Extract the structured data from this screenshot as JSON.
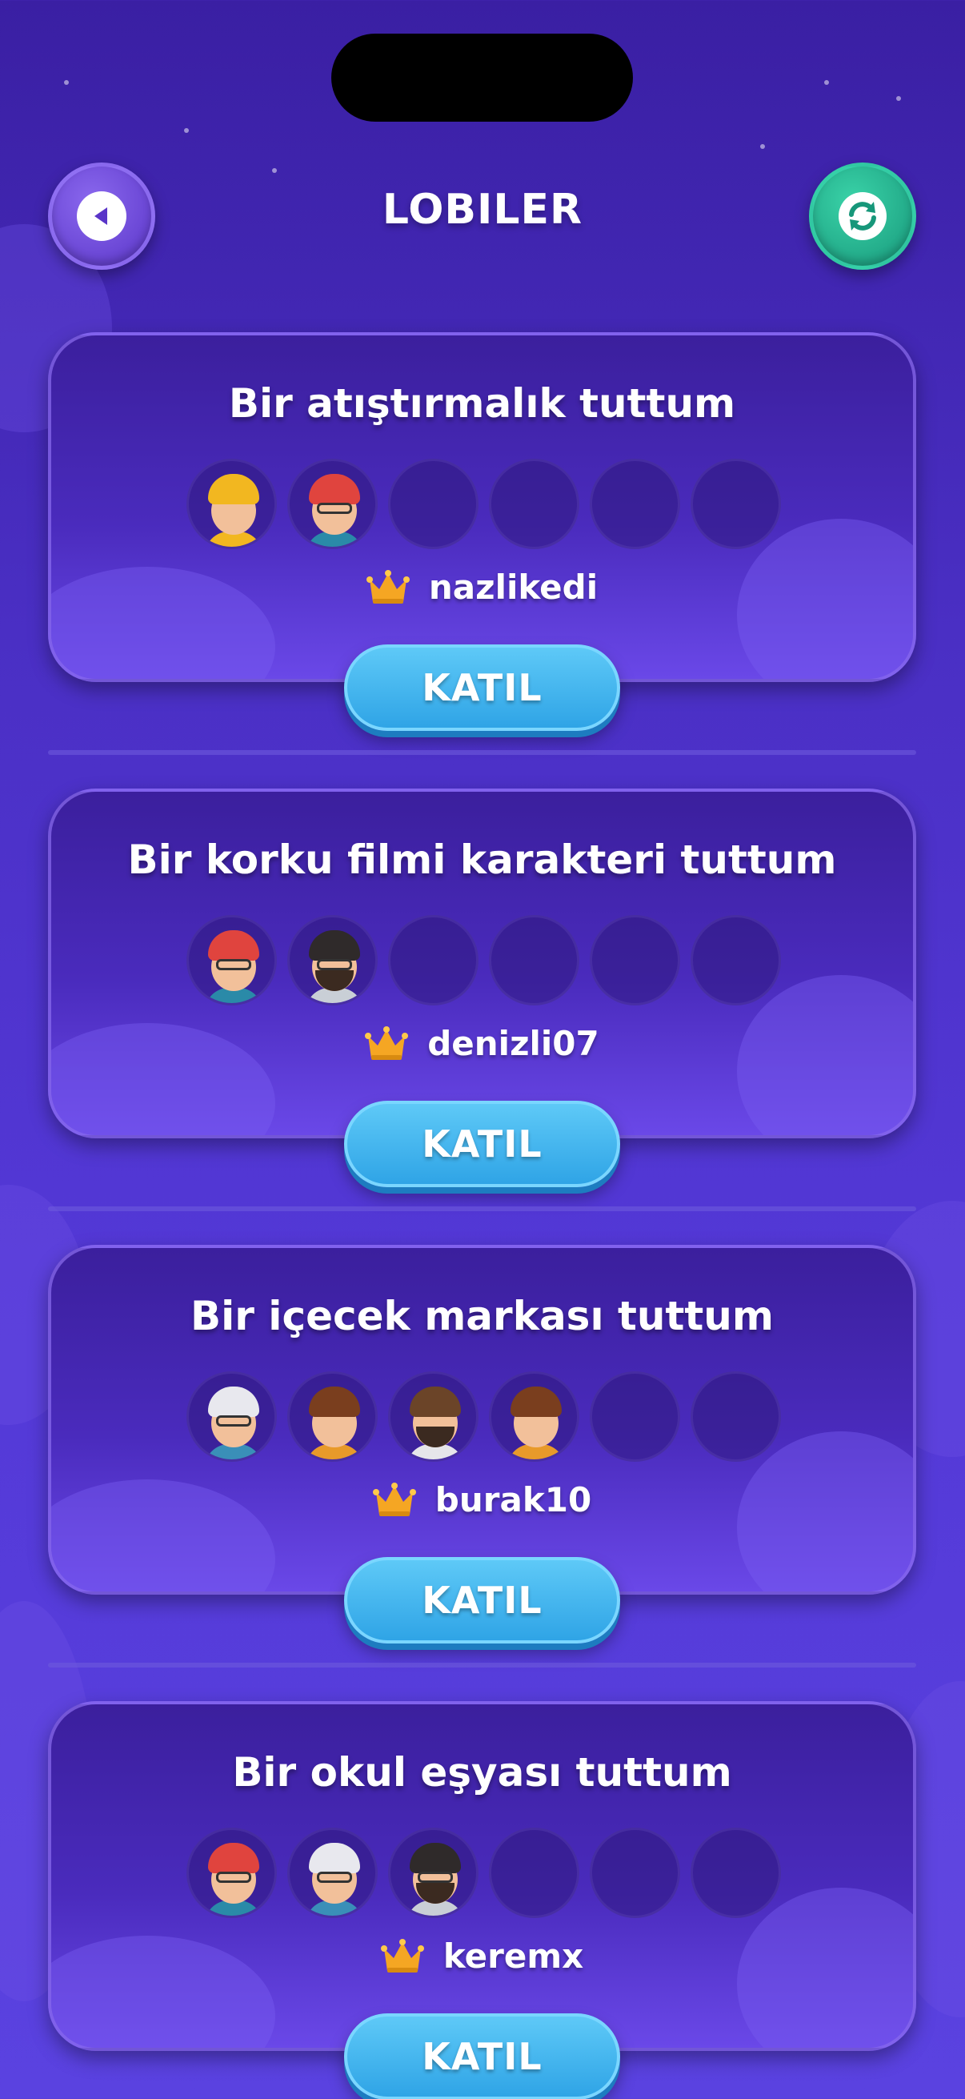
{
  "header": {
    "title": "LOBILER",
    "back_icon": "back-arrow-icon",
    "refresh_icon": "refresh-icon"
  },
  "lobbies": [
    {
      "title": "Bir atıştırmalık tuttum",
      "host": "nazlikedi",
      "join_label": "KATIL",
      "players": [
        "girl-yellow-beanie",
        "boy-red-cap",
        null,
        null,
        null,
        null
      ]
    },
    {
      "title": "Bir korku filmi karakteri tuttum",
      "host": "denizli07",
      "join_label": "KATIL",
      "players": [
        "boy-red-cap",
        "man-beard-glasses",
        null,
        null,
        null,
        null
      ]
    },
    {
      "title": "Bir içecek markası tuttum",
      "host": "burak10",
      "join_label": "KATIL",
      "players": [
        "girl-white-beanie",
        "girl-brown-hair",
        "man-beard",
        "girl-brown-hair",
        null,
        null
      ]
    },
    {
      "title": "Bir okul eşyası tuttum",
      "host": "keremx",
      "join_label": "KATIL",
      "players": [
        "boy-red-cap",
        "girl-white-beanie",
        "man-beard-glasses",
        null,
        null,
        null
      ]
    }
  ],
  "colors": {
    "crown": "#f5a623",
    "join": "#3fb3ef",
    "refresh": "#1fa886",
    "back": "#6a45d8"
  }
}
